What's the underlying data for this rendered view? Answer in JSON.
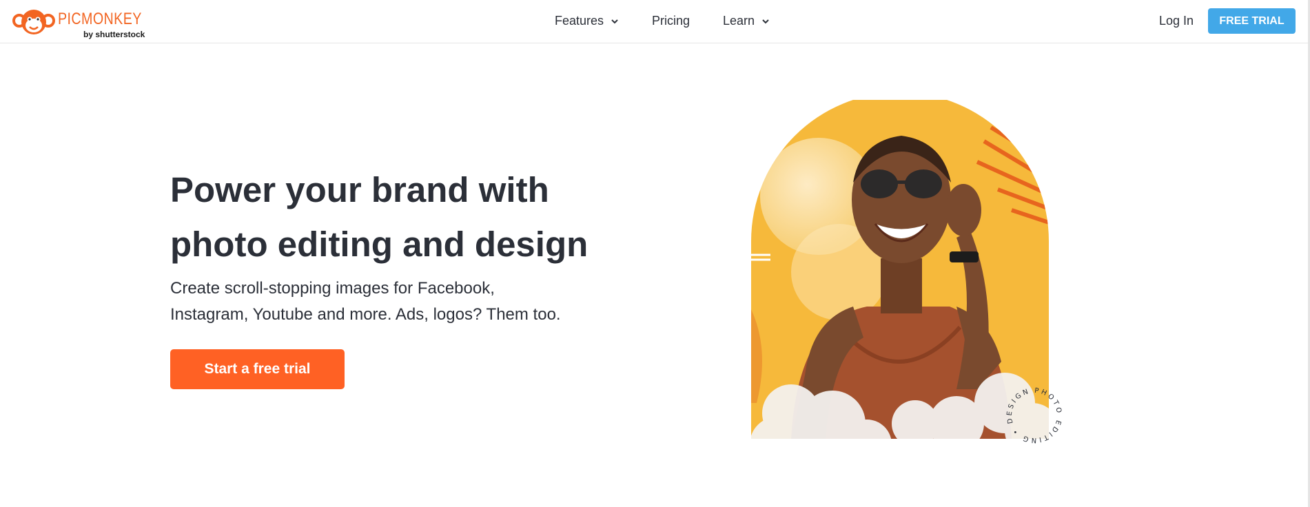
{
  "header": {
    "logo_text": "PICMONKEY",
    "logo_sub": "by shutterstock",
    "nav": [
      {
        "label": "Features",
        "has_dropdown": true
      },
      {
        "label": "Pricing",
        "has_dropdown": false
      },
      {
        "label": "Learn",
        "has_dropdown": true
      }
    ],
    "login_label": "Log In",
    "trial_label": "FREE TRIAL"
  },
  "hero": {
    "headline_line1": "Power your brand with",
    "headline_line2": "photo editing and design",
    "subtext_line1": "Create scroll-stopping images for Facebook,",
    "subtext_line2": "Instagram, Youtube and more. Ads, logos? Them too.",
    "cta_label": "Start a free trial",
    "badge_text": "PHOTO EDITING • DESIGN •"
  },
  "colors": {
    "brand_orange": "#f26522",
    "cta_orange": "#ff6124",
    "trial_blue": "#42a8e8",
    "text_dark": "#2b2f38",
    "arch_yellow": "#f6b93b"
  }
}
